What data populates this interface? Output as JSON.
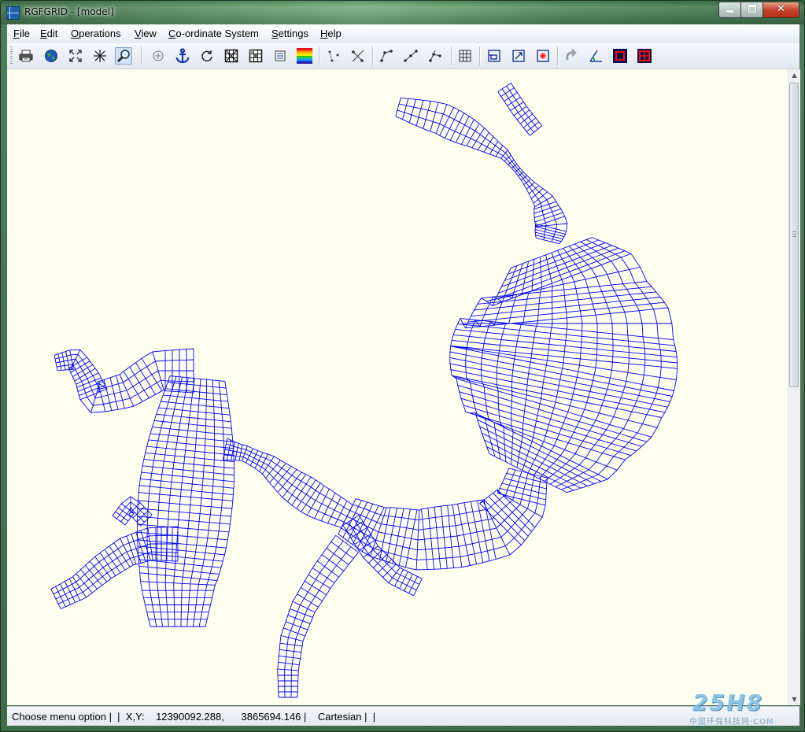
{
  "window": {
    "title": "RGFGRID - [model]",
    "controls": {
      "minimize": "minimize",
      "maximize": "maximize",
      "close": "close"
    }
  },
  "menu": {
    "items": [
      {
        "label": "File",
        "mnemonic": "F"
      },
      {
        "label": "Edit",
        "mnemonic": "E"
      },
      {
        "label": "Operations",
        "mnemonic": "O"
      },
      {
        "label": "View",
        "mnemonic": "V"
      },
      {
        "label": "Co-ordinate System",
        "mnemonic": "C"
      },
      {
        "label": "Settings",
        "mnemonic": "S"
      },
      {
        "label": "Help",
        "mnemonic": "H"
      }
    ]
  },
  "toolbar": {
    "buttons": [
      {
        "icon": "print-icon"
      },
      {
        "icon": "globe-icon"
      },
      {
        "icon": "zoom-extents-icon"
      },
      {
        "icon": "zoom-in-arrows-icon"
      },
      {
        "icon": "zoom-box-icon",
        "pressed": true
      },
      {
        "icon": "pan-crosshair-icon"
      },
      {
        "icon": "anchor-icon"
      },
      {
        "icon": "refresh-icon"
      },
      {
        "icon": "grid-hatch-icon"
      },
      {
        "icon": "grid-hatch-2-icon"
      },
      {
        "icon": "list-icon"
      },
      {
        "icon": "color-legend-icon"
      },
      {
        "icon": "spline-points-icon"
      },
      {
        "icon": "spline-delete-icon"
      },
      {
        "icon": "spline-insert-icon"
      },
      {
        "icon": "spline-move-icon"
      },
      {
        "icon": "spline-split-icon"
      },
      {
        "icon": "grid-icon"
      },
      {
        "icon": "refine-grid-icon"
      },
      {
        "icon": "grid-orthogonalise-icon"
      },
      {
        "icon": "grid-point-icon"
      },
      {
        "icon": "undo-curve-icon"
      },
      {
        "icon": "axis-angle-icon"
      },
      {
        "icon": "black-box-icon"
      },
      {
        "icon": "black-grid-box-icon"
      }
    ]
  },
  "canvas": {
    "background": "#fffff0",
    "grid_color": "#0000ff"
  },
  "statusbar": {
    "text": "Choose menu option |  |  X,Y:    12390092.288,      3865694.146 |    Cartesian |  |"
  },
  "watermark": {
    "logo": "25H8",
    "subtitle": "中国环保科技网·COM"
  }
}
